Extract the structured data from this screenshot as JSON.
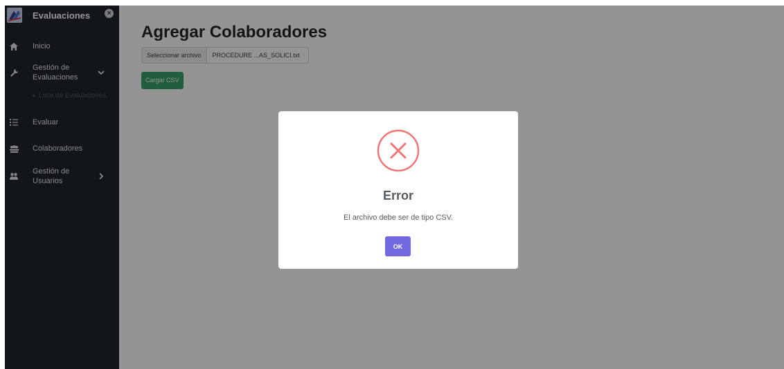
{
  "sidebar": {
    "brand_title": "Evaluaciones",
    "close_glyph": "×",
    "items": [
      {
        "label": "Inicio",
        "icon": "home-icon"
      },
      {
        "label": "Gestión de Evaluaciones",
        "label_line1": "Gestión de",
        "label_line2": "Evaluaciones",
        "icon": "wrench-icon",
        "chevron": "chevron-down-icon"
      },
      {
        "label": "Evaluar",
        "icon": "list-icon"
      },
      {
        "label": "Colaboradores",
        "icon": "group-icon"
      },
      {
        "label": "Gestión de Usuarios",
        "label_line1": "Gestión de",
        "label_line2": "Usuarios",
        "icon": "users-icon",
        "chevron": "chevron-right-icon"
      }
    ],
    "sub_items": [
      {
        "label": "Lista de Evaluaciones"
      }
    ]
  },
  "main": {
    "title": "Agregar Colaboradores",
    "file_input": {
      "button_label": "Seleccionar archivo",
      "file_name": "PROCEDURE ...AS_SOLICI.txt"
    },
    "upload_button_label": "Cargar CSV"
  },
  "modal": {
    "icon": "error-x-icon",
    "title": "Error",
    "message": "El archivo debe ser de tipo CSV.",
    "ok_label": "OK"
  },
  "colors": {
    "sidebar_bg": "#1f252c",
    "upload_button": "#38a36b",
    "ok_button": "#7367e0",
    "error_icon": "#f27474"
  }
}
